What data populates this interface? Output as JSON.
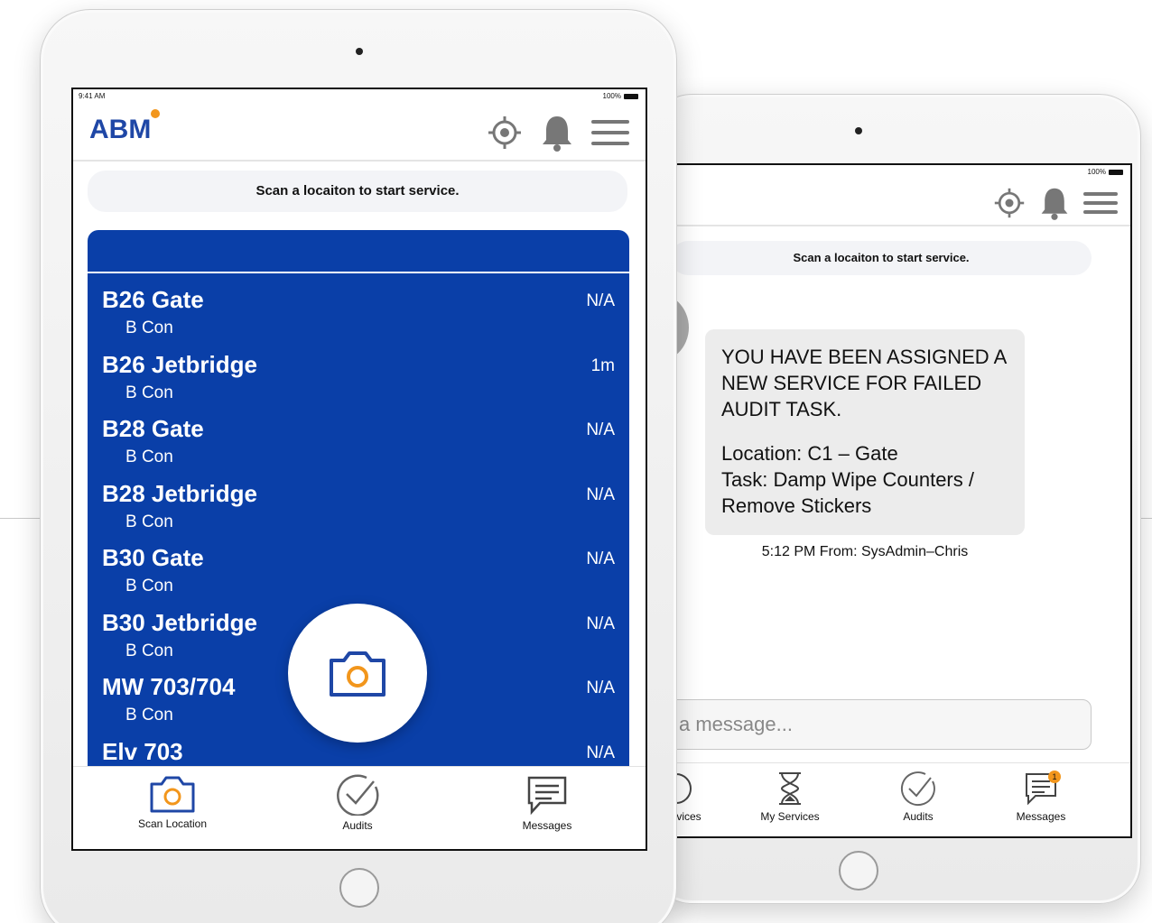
{
  "front": {
    "status": {
      "time": "9:41 AM",
      "battery": "100%"
    },
    "logo": "ABM",
    "banner": "Scan a locaiton to start service.",
    "list": [
      {
        "name": "B26 Gate",
        "sub": "B Con",
        "value": "N/A"
      },
      {
        "name": "B26 Jetbridge",
        "sub": "B Con",
        "value": "1m"
      },
      {
        "name": "B28 Gate",
        "sub": "B Con",
        "value": "N/A"
      },
      {
        "name": "B28 Jetbridge",
        "sub": "B Con",
        "value": "N/A"
      },
      {
        "name": "B30 Gate",
        "sub": "B Con",
        "value": "N/A"
      },
      {
        "name": "B30 Jetbridge",
        "sub": "B Con",
        "value": "N/A"
      },
      {
        "name": "MW 703/704",
        "sub": "B Con",
        "value": "N/A"
      },
      {
        "name": "Elv 703",
        "sub": "",
        "value": "N/A"
      }
    ],
    "tabs": {
      "scan": "Scan Location",
      "audits": "Audits",
      "messages": "Messages"
    }
  },
  "back": {
    "status": {
      "battery": "100%"
    },
    "banner": "Scan a locaiton to start service.",
    "message": {
      "line1": "YOU HAVE BEEN ASSIGNED A NEW SERVICE FOR FAILED AUDIT TASK.",
      "location": "Location: C1 – Gate",
      "task": "Task: Damp Wipe Counters / Remove Stickers",
      "meta": "5:12 PM From: SysAdmin–Chris"
    },
    "input_placeholder": "a message...",
    "tabs": {
      "services": "vices",
      "my_services": "My Services",
      "audits": "Audits",
      "messages": "Messages"
    },
    "messages_badge": "1"
  },
  "colors": {
    "brand_blue": "#0a3fa8",
    "logo_blue": "#1f47a6",
    "accent_orange": "#f2961c"
  }
}
